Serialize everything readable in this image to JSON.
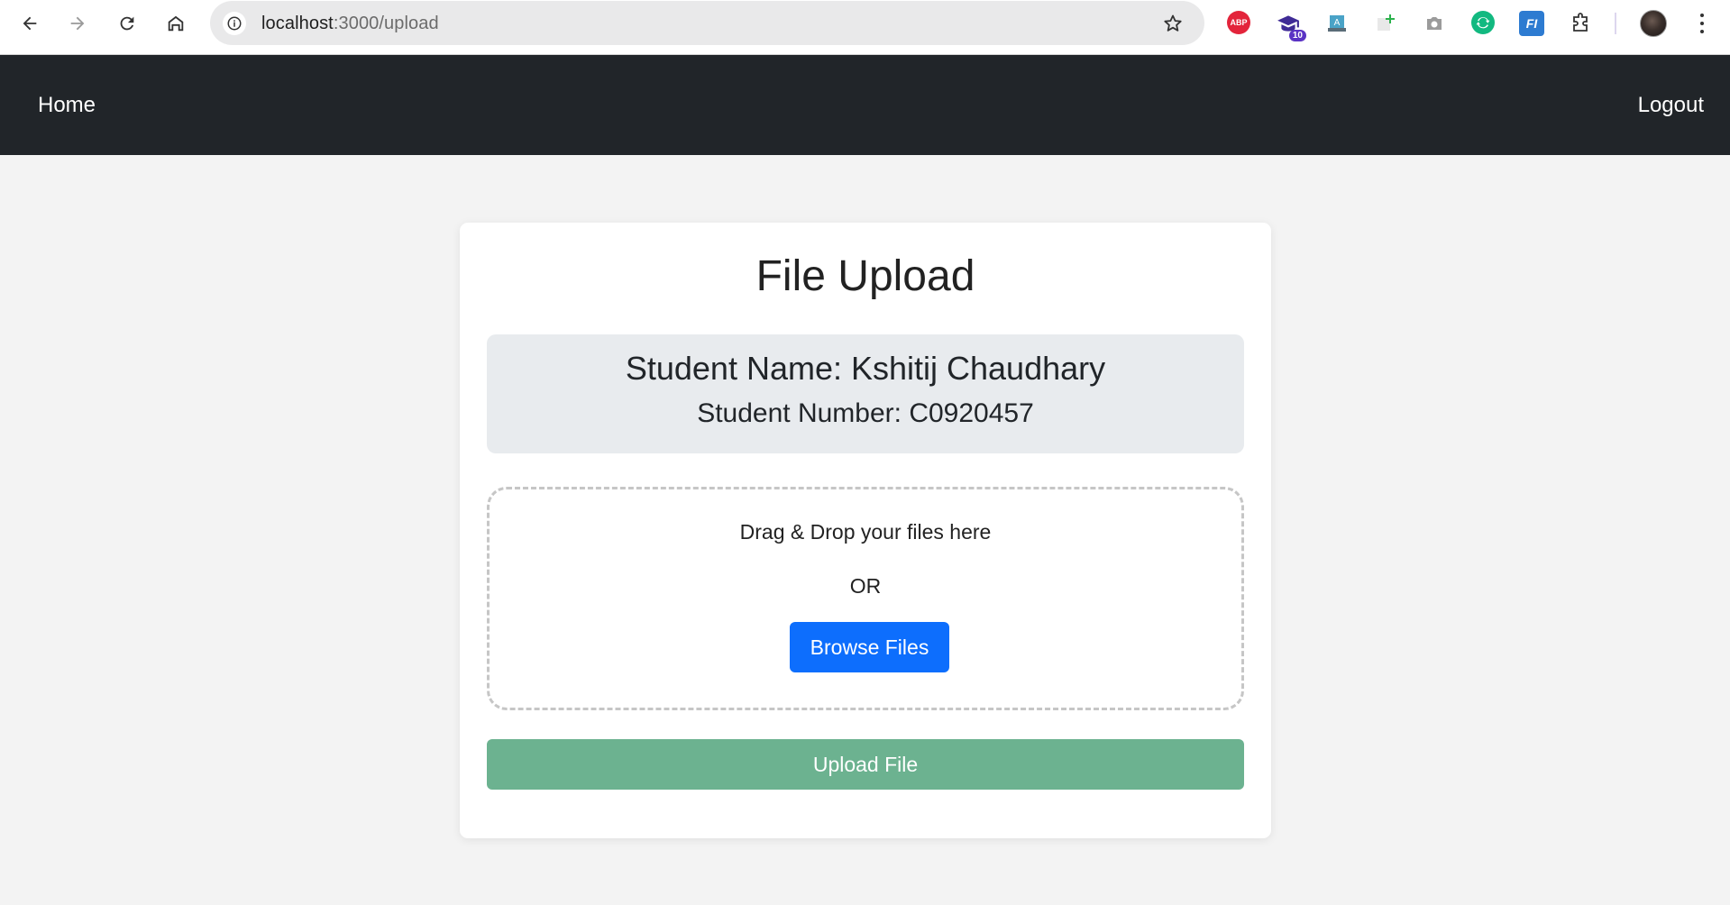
{
  "browser": {
    "url_host": "localhost",
    "url_path": ":3000/upload",
    "extensions": [
      {
        "name": "adblock-plus",
        "label": "ABP"
      },
      {
        "name": "graduation-cap",
        "badge": "10"
      },
      {
        "name": "fi",
        "label": "FI"
      }
    ]
  },
  "navbar": {
    "home_label": "Home",
    "logout_label": "Logout",
    "background": "#212529"
  },
  "card": {
    "title": "File Upload",
    "student_name": "Student Name: Kshitij Chaudhary",
    "student_number": "Student Number: C0920457",
    "dropzone": {
      "instruction": "Drag & Drop your files here",
      "separator": "OR",
      "browse_label": "Browse Files"
    },
    "upload_label": "Upload File"
  },
  "colors": {
    "primary": "#0d6efd",
    "success_disabled": "#6cb290",
    "page_bg": "#f3f3f3"
  }
}
